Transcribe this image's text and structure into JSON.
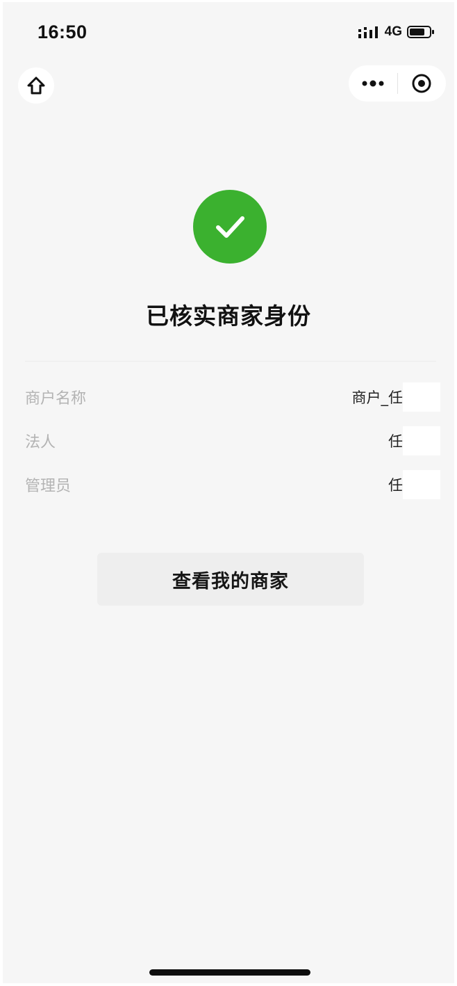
{
  "status_bar": {
    "time": "16:50",
    "network": "4G"
  },
  "nav": {
    "home_icon": "home-icon",
    "more_icon": "more-dots-icon",
    "close_icon": "target-circle-icon"
  },
  "result": {
    "icon": "check-circle-icon",
    "title": "已核实商家身份",
    "accent_color": "#3bb12f"
  },
  "info": [
    {
      "label": "商户名称",
      "value": "商户_任"
    },
    {
      "label": "法人",
      "value": "任"
    },
    {
      "label": "管理员",
      "value": "任"
    }
  ],
  "actions": {
    "view_merchant_label": "查看我的商家"
  }
}
